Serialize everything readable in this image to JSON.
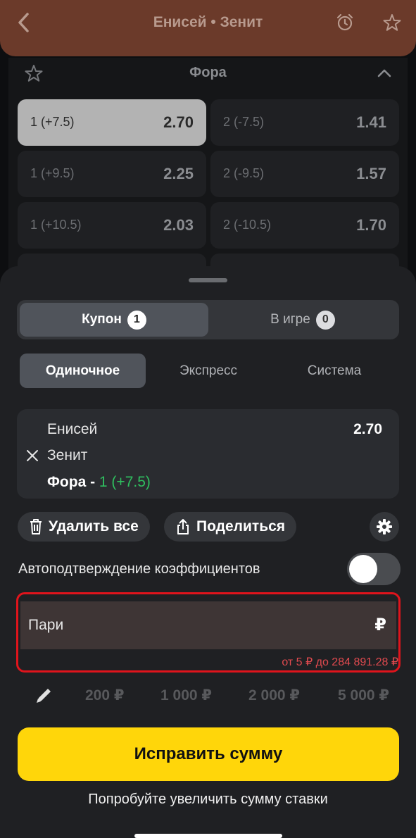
{
  "header": {
    "title": "Енисей • Зенит"
  },
  "market": {
    "title": "Фора",
    "odds": [
      {
        "label": "1 (+7.5)",
        "value": "2.70",
        "selected": true
      },
      {
        "label": "2 (-7.5)",
        "value": "1.41",
        "selected": false
      },
      {
        "label": "1 (+9.5)",
        "value": "2.25",
        "selected": false
      },
      {
        "label": "2 (-9.5)",
        "value": "1.57",
        "selected": false
      },
      {
        "label": "1 (+10.5)",
        "value": "2.03",
        "selected": false
      },
      {
        "label": "2 (-10.5)",
        "value": "1.70",
        "selected": false
      }
    ]
  },
  "sheet": {
    "tabs": [
      {
        "label": "Купон",
        "count": "1"
      },
      {
        "label": "В игре",
        "count": "0"
      }
    ],
    "bet_types": [
      "Одиночное",
      "Экспресс",
      "Система"
    ],
    "coupon": {
      "team1": "Енисей",
      "team2": "Зенит",
      "odds": "2.70",
      "market_prefix": "Фора - ",
      "market_value": "1 (+7.5)"
    },
    "delete_all": "Удалить все",
    "share": "Поделиться",
    "auto_confirm": "Автоподтверждение коэффициентов",
    "stake": {
      "placeholder": "Пари",
      "currency": "₽",
      "limits": "от 5 ₽ до 284 891.28 ₽"
    },
    "quick_amounts": [
      "200 ₽",
      "1 000 ₽",
      "2 000 ₽",
      "5 000 ₽"
    ],
    "cta": "Исправить сумму",
    "hint": "Попробуйте увеличить сумму ставки"
  },
  "colors": {
    "header": "#6b3a2a",
    "cta": "#ffd60a",
    "error": "#e0141c",
    "green": "#2fbf5f"
  }
}
